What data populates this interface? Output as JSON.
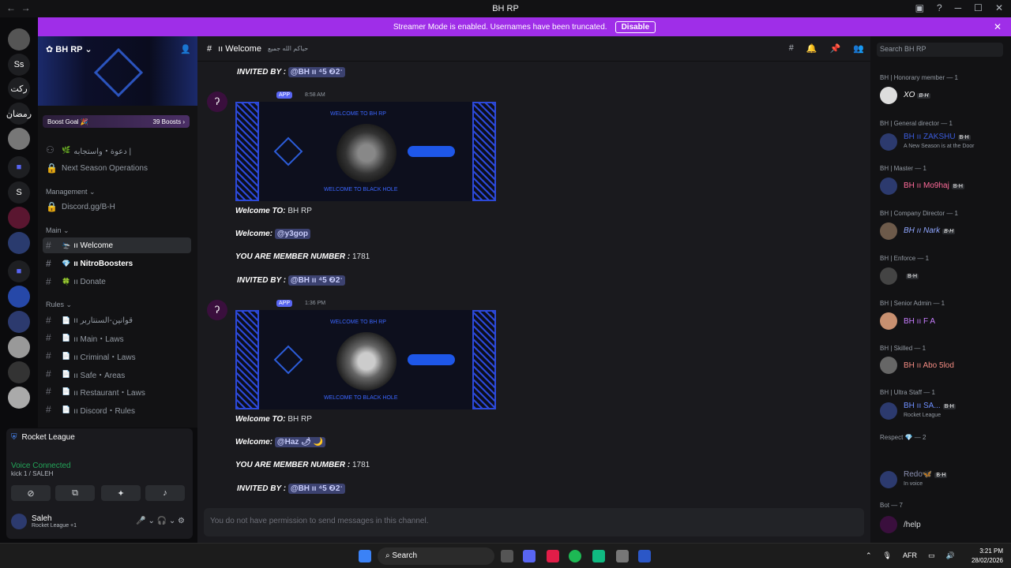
{
  "window": {
    "title": "BH RP"
  },
  "banner": {
    "text": "Streamer Mode is enabled. Usernames have been truncated.",
    "button": "Disable"
  },
  "server": {
    "name": "BH RP",
    "boost_goal": "Boost Goal 🎉",
    "boosts": "39 Boosts ›"
  },
  "channels": {
    "invite": "دعوة・واستجابه |",
    "next_season": "Next Season Operations",
    "management_cat": "Management ⌄",
    "discord_link": "Discord.gg/B-H",
    "main_cat": "Main ⌄",
    "welcome": "ıı Welcome",
    "nitro": "ıı NitroBoosters",
    "donate": "ıı Donate",
    "rules_cat": "Rules ⌄",
    "rules": [
      "ıı قوانين-السنتاربر",
      "ıı Main・Laws",
      "ıı Criminal・Laws",
      "ıı Safe・Areas",
      "ıı Restaurant・Laws",
      "ıı Discord・Rules"
    ]
  },
  "panel": {
    "game": "Rocket League",
    "voice": "Voice Connected",
    "voice_sub": "kick 1 / SALEH",
    "user": "Saleh",
    "user_status": "Rocket League +1"
  },
  "channel_header": {
    "name": "ıı Welcome",
    "topic": "حياكم الله جميع"
  },
  "messages": {
    "invited_label": "INVITED BY :",
    "invited_mention": "@BH ıı ⁴5 ❷2ˑ",
    "app_tag": "APP",
    "m1_time": "8:58 AM",
    "m2_time": "1:36 PM",
    "img_title": "WELCOME TO BH RP",
    "img_footer": "WELCOME TO BLACK HOLE",
    "welcome_to_label": "Welcome TO:",
    "welcome_to_value": "BH RP",
    "welcome_label": "Welcome:",
    "m1_mention": "@y3gop",
    "m2_mention": "@Haz 🌶 🌙",
    "member_label": "YOU ARE MEMBER NUMBER :",
    "member_number": "1781"
  },
  "input_placeholder": "You do not have permission to send messages in this channel.",
  "search_placeholder": "Search BH RP",
  "members": {
    "c1": "BH | Honorary member — 1",
    "m1": "XO",
    "c2": "BH | General director — 1",
    "m2": "BH ıı ZAKSHU",
    "m2s": "A New Season is at the Door",
    "c3": "BH | Master — 1",
    "m3": "BH ıı Mo9haj",
    "c4": "BH | Company Director — 1",
    "m4": "BH ıı Nark",
    "c5": "BH | Enforce — 1",
    "c6": "BH | Senior Admin — 1",
    "m6": "BH ıı F A",
    "c7": "BH | Skilled — 1",
    "m7": "BH ıı Abo 5lod",
    "c8": "BH | Ultra Staff — 1",
    "m8": "BH ıı SA...",
    "m8s": "Rocket League",
    "c9": "Respect 💎 — 2",
    "m9b": "Redo🦋",
    "m9bs": "In voice",
    "c10": "Bot — 7",
    "m10": "/help",
    "tag": "B-H"
  },
  "taskbar": {
    "search": "Search",
    "lang": "AFR",
    "time": "3:21 PM",
    "date": "28/02/2026"
  }
}
